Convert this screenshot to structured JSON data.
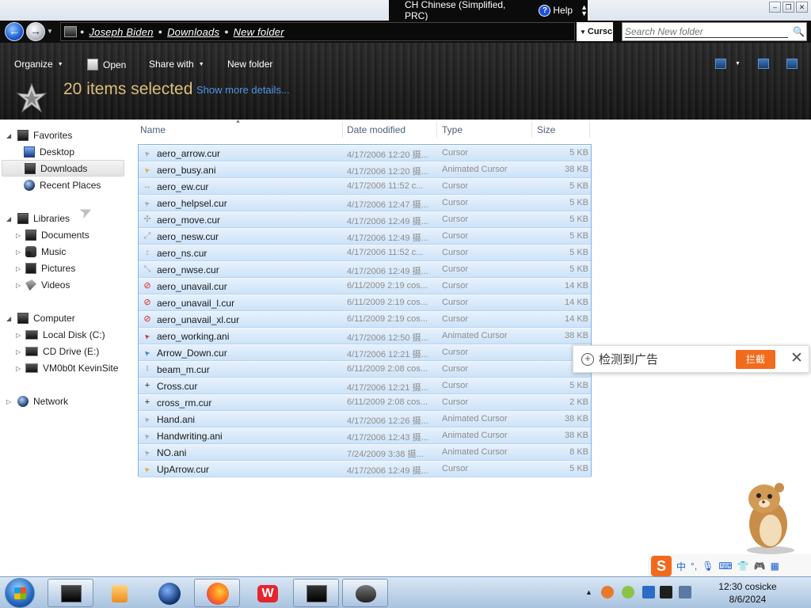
{
  "language_bar": {
    "language": "CH Chinese (Simplified, PRC)",
    "help_label": "Help"
  },
  "address": {
    "crumbs": [
      "Joseph Biden",
      "Downloads",
      "New folder"
    ],
    "side_label": "Cursc"
  },
  "search": {
    "placeholder": "Search New folder"
  },
  "commands": {
    "organize": "Organize",
    "open": "Open",
    "share_with": "Share with",
    "new_folder": "New folder"
  },
  "details": {
    "selected_count": "20 items selected",
    "show_more": "Show more details..."
  },
  "nav": {
    "favorites": "Favorites",
    "desktop": "Desktop",
    "downloads": "Downloads",
    "recent_places": "Recent Places",
    "libraries": "Libraries",
    "documents": "Documents",
    "music": "Music",
    "pictures": "Pictures",
    "videos": "Videos",
    "computer": "Computer",
    "local_disk": "Local Disk (C:)",
    "cd_drive": "CD Drive (E:)",
    "vm_share": "VM0b0t KevinSite",
    "network": "Network"
  },
  "columns": {
    "name": "Name",
    "date": "Date modified",
    "type": "Type",
    "size": "Size"
  },
  "files": [
    {
      "name": "aero_arrow.cur",
      "date": "4/17/2006 12:20 摄...",
      "type": "Cursor",
      "size": "5 KB",
      "icon": "arrow-cursor-icon"
    },
    {
      "name": "aero_busy.ani",
      "date": "4/17/2006 12:20 摄...",
      "type": "Animated Cursor",
      "size": "38 KB",
      "icon": "busy-cursor-icon"
    },
    {
      "name": "aero_ew.cur",
      "date": "4/17/2006 11:52 c...",
      "type": "Cursor",
      "size": "5 KB",
      "icon": "resize-ew-icon"
    },
    {
      "name": "aero_helpsel.cur",
      "date": "4/17/2006 12:47 摄...",
      "type": "Cursor",
      "size": "5 KB",
      "icon": "help-cursor-icon"
    },
    {
      "name": "aero_move.cur",
      "date": "4/17/2006 12:49 摄...",
      "type": "Cursor",
      "size": "5 KB",
      "icon": "move-cursor-icon"
    },
    {
      "name": "aero_nesw.cur",
      "date": "4/17/2006 12:49 摄...",
      "type": "Cursor",
      "size": "5 KB",
      "icon": "resize-nesw-icon"
    },
    {
      "name": "aero_ns.cur",
      "date": "4/17/2006 11:52 c...",
      "type": "Cursor",
      "size": "5 KB",
      "icon": "resize-ns-icon"
    },
    {
      "name": "aero_nwse.cur",
      "date": "4/17/2006 12:49 摄...",
      "type": "Cursor",
      "size": "5 KB",
      "icon": "resize-nwse-icon"
    },
    {
      "name": "aero_unavail.cur",
      "date": "6/11/2009 2:19 cos...",
      "type": "Cursor",
      "size": "14 KB",
      "icon": "unavailable-icon"
    },
    {
      "name": "aero_unavail_l.cur",
      "date": "6/11/2009 2:19 cos...",
      "type": "Cursor",
      "size": "14 KB",
      "icon": "unavailable-icon"
    },
    {
      "name": "aero_unavail_xl.cur",
      "date": "6/11/2009 2:19 cos...",
      "type": "Cursor",
      "size": "14 KB",
      "icon": "unavailable-icon"
    },
    {
      "name": "aero_working.ani",
      "date": "4/17/2006 12:50 摄...",
      "type": "Animated Cursor",
      "size": "38 KB",
      "icon": "working-cursor-icon"
    },
    {
      "name": "Arrow_Down.cur",
      "date": "4/17/2006 12:21 摄...",
      "type": "Cursor",
      "size": "",
      "icon": "arrow-down-cursor-icon"
    },
    {
      "name": "beam_m.cur",
      "date": "6/11/2009 2:08 cos...",
      "type": "Cursor",
      "size": "",
      "icon": "beam-cursor-icon"
    },
    {
      "name": "Cross.cur",
      "date": "4/17/2006 12:21 摄...",
      "type": "Cursor",
      "size": "5 KB",
      "icon": "cross-cursor-icon"
    },
    {
      "name": "cross_rm.cur",
      "date": "6/11/2009 2:08 cos...",
      "type": "Cursor",
      "size": "2 KB",
      "icon": "cross-cursor-icon"
    },
    {
      "name": "Hand.ani",
      "date": "4/17/2006 12:26 摄...",
      "type": "Animated Cursor",
      "size": "38 KB",
      "icon": "hand-cursor-icon"
    },
    {
      "name": "Handwriting.ani",
      "date": "4/17/2006 12:43 摄...",
      "type": "Animated Cursor",
      "size": "38 KB",
      "icon": "handwriting-cursor-icon"
    },
    {
      "name": "NO.ani",
      "date": "7/24/2009 3:38 摄...",
      "type": "Animated Cursor",
      "size": "8 KB",
      "icon": "no-cursor-icon"
    },
    {
      "name": "UpArrow.cur",
      "date": "4/17/2006 12:49 摄...",
      "type": "Cursor",
      "size": "5 KB",
      "icon": "up-arrow-cursor-icon"
    }
  ],
  "ad": {
    "text": "检测到广告",
    "block_label": "拦截"
  },
  "ime": {
    "mode": "中",
    "punct": "°,"
  },
  "clock": {
    "time": "12:30 cosicke",
    "date": "8/6/2024"
  },
  "colors": {
    "selection": "#cde3f8",
    "selection_border": "#82b2e5",
    "accent_orange": "#f26b1d",
    "details_text": "#ddbe7a",
    "link_blue": "#4d96e6"
  }
}
